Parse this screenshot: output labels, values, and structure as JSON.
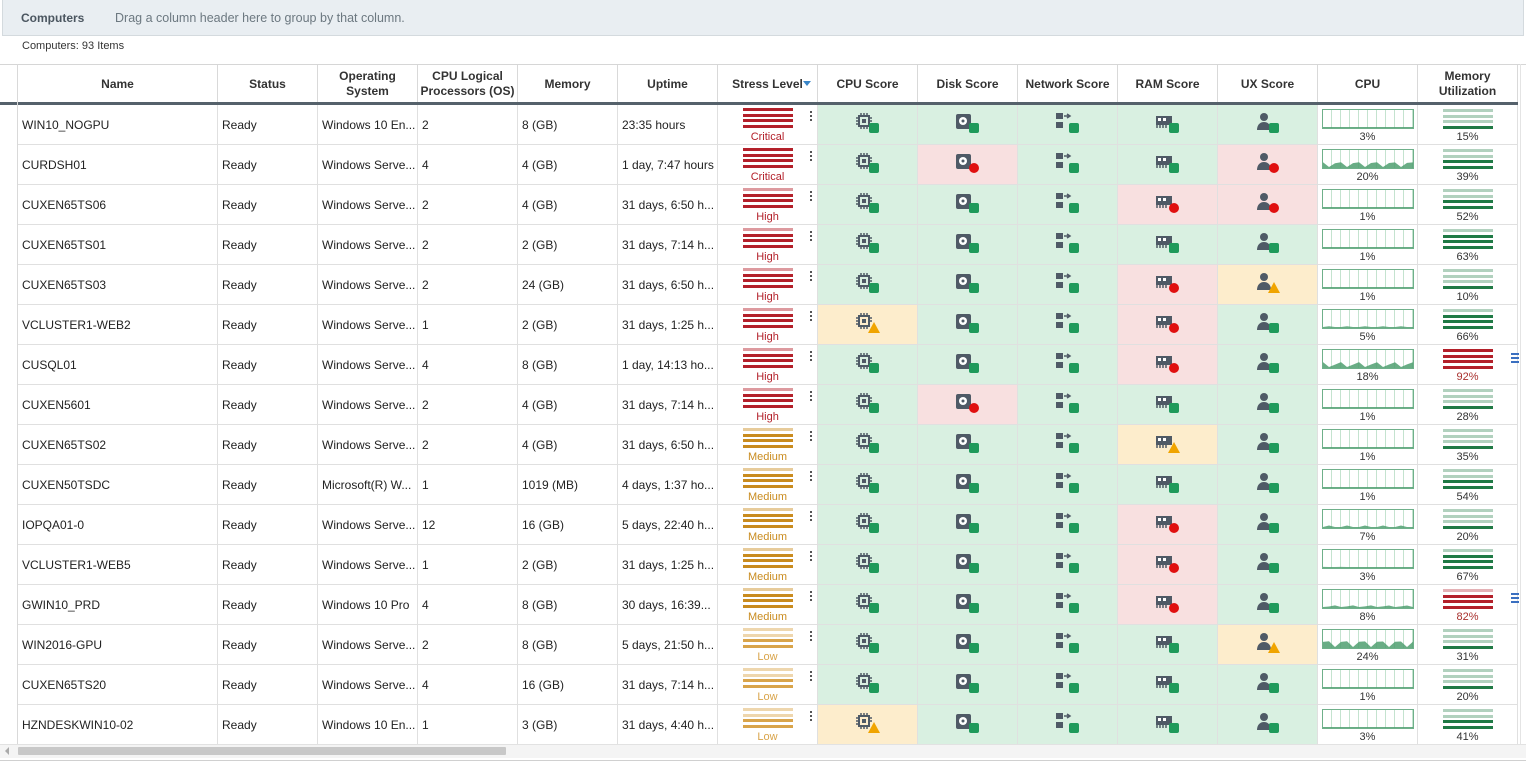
{
  "group_panel": {
    "title": "Computers",
    "hint": "Drag a column header here to group by that column."
  },
  "items_count": "Computers: 93 Items",
  "columns": [
    {
      "key": "name",
      "label": "Name"
    },
    {
      "key": "status",
      "label": "Status"
    },
    {
      "key": "os",
      "label": "Operating System"
    },
    {
      "key": "cpu_lp",
      "label": "CPU Logical Processors (OS)"
    },
    {
      "key": "memory",
      "label": "Memory"
    },
    {
      "key": "uptime",
      "label": "Uptime"
    },
    {
      "key": "stress",
      "label": "Stress Level",
      "sorted": "descending"
    },
    {
      "key": "cpu_score",
      "label": "CPU Score"
    },
    {
      "key": "disk_score",
      "label": "Disk Score"
    },
    {
      "key": "net_score",
      "label": "Network Score"
    },
    {
      "key": "ram_score",
      "label": "RAM Score"
    },
    {
      "key": "ux_score",
      "label": "UX Score"
    },
    {
      "key": "cpu",
      "label": "CPU"
    },
    {
      "key": "mem_util",
      "label": "Memory Utilization"
    }
  ],
  "colors": {
    "critical": "#b3202a",
    "high": "#b3202a",
    "medium": "#c98b1e",
    "low": "#d9a44a",
    "good_bg": "#d9f0e1",
    "bad_bg": "#f8e0e0",
    "warn_bg": "#fdedcc",
    "ok_badge": "#1f9a5b",
    "bad_badge": "#e01010",
    "warn_badge": "#f0a400",
    "icon_gray": "#4f5a66",
    "mem_green": "#1f7a45",
    "mem_red": "#b3202a"
  },
  "rows": [
    {
      "name": "WIN10_NOGPU",
      "status": "Ready",
      "os": "Windows 10 En...",
      "cpu_lp": "2",
      "memory": "8 (GB)",
      "uptime": "23:35 hours",
      "stress": "Critical",
      "scores": [
        "ok",
        "ok",
        "ok",
        "ok",
        "ok"
      ],
      "cpu": "3%",
      "cpu_level": 0.03,
      "mem": "15%",
      "mem_level": 0.15
    },
    {
      "name": "CURDSH01",
      "status": "Ready",
      "os": "Windows  Serve...",
      "cpu_lp": "4",
      "memory": "4 (GB)",
      "uptime": "1 day, 7:47 hours",
      "stress": "Critical",
      "scores": [
        "ok",
        "bad",
        "ok",
        "ok",
        "bad"
      ],
      "cpu": "20%",
      "cpu_level": 0.2,
      "mem": "39%",
      "mem_level": 0.39
    },
    {
      "name": "CUXEN65TS06",
      "status": "Ready",
      "os": "Windows  Serve...",
      "cpu_lp": "2",
      "memory": "4 (GB)",
      "uptime": "31 days, 6:50 h...",
      "stress": "High",
      "scores": [
        "ok",
        "ok",
        "ok",
        "bad",
        "bad"
      ],
      "cpu": "1%",
      "cpu_level": 0.01,
      "mem": "52%",
      "mem_level": 0.52
    },
    {
      "name": "CUXEN65TS01",
      "status": "Ready",
      "os": "Windows  Serve...",
      "cpu_lp": "2",
      "memory": "2 (GB)",
      "uptime": "31 days, 7:14 h...",
      "stress": "High",
      "scores": [
        "ok",
        "ok",
        "ok",
        "ok",
        "ok"
      ],
      "cpu": "1%",
      "cpu_level": 0.01,
      "mem": "63%",
      "mem_level": 0.63
    },
    {
      "name": "CUXEN65TS03",
      "status": "Ready",
      "os": "Windows  Serve...",
      "cpu_lp": "2",
      "memory": "24 (GB)",
      "uptime": "31 days, 6:50 h...",
      "stress": "High",
      "scores": [
        "ok",
        "ok",
        "ok",
        "bad",
        "warn"
      ],
      "cpu": "1%",
      "cpu_level": 0.01,
      "mem": "10%",
      "mem_level": 0.1
    },
    {
      "name": "VCLUSTER1-WEB2",
      "status": "Ready",
      "os": "Windows  Serve...",
      "cpu_lp": "1",
      "memory": "2 (GB)",
      "uptime": "31 days, 1:25 h...",
      "stress": "High",
      "scores": [
        "warn",
        "ok",
        "ok",
        "bad",
        "ok"
      ],
      "cpu": "5%",
      "cpu_level": 0.05,
      "mem": "66%",
      "mem_level": 0.66
    },
    {
      "name": "CUSQL01",
      "status": "Ready",
      "os": "Windows  Serve...",
      "cpu_lp": "4",
      "memory": "8 (GB)",
      "uptime": "1 day, 14:13 ho...",
      "stress": "High",
      "scores": [
        "ok",
        "ok",
        "ok",
        "bad",
        "ok"
      ],
      "cpu": "18%",
      "cpu_level": 0.18,
      "mem": "92%",
      "mem_level": 0.92
    },
    {
      "name": "CUXEN5601",
      "status": "Ready",
      "os": "Windows  Serve...",
      "cpu_lp": "2",
      "memory": "4 (GB)",
      "uptime": "31 days, 7:14 h...",
      "stress": "High",
      "scores": [
        "ok",
        "bad",
        "ok",
        "ok",
        "ok"
      ],
      "cpu": "1%",
      "cpu_level": 0.01,
      "mem": "28%",
      "mem_level": 0.28
    },
    {
      "name": "CUXEN65TS02",
      "status": "Ready",
      "os": "Windows  Serve...",
      "cpu_lp": "2",
      "memory": "4 (GB)",
      "uptime": "31 days, 6:50 h...",
      "stress": "Medium",
      "scores": [
        "ok",
        "ok",
        "ok",
        "warn",
        "ok"
      ],
      "cpu": "1%",
      "cpu_level": 0.01,
      "mem": "35%",
      "mem_level": 0.35
    },
    {
      "name": "CUXEN50TSDC",
      "status": "Ready",
      "os": "Microsoft(R) W...",
      "cpu_lp": "1",
      "memory": "1019 (MB)",
      "uptime": "4 days, 1:37 ho...",
      "stress": "Medium",
      "scores": [
        "ok",
        "ok",
        "ok",
        "ok",
        "ok"
      ],
      "cpu": "1%",
      "cpu_level": 0.01,
      "mem": "54%",
      "mem_level": 0.54
    },
    {
      "name": "IOPQA01-0",
      "status": "Ready",
      "os": "Windows  Serve...",
      "cpu_lp": "12",
      "memory": "16 (GB)",
      "uptime": "5 days, 22:40 h...",
      "stress": "Medium",
      "scores": [
        "ok",
        "ok",
        "ok",
        "bad",
        "ok"
      ],
      "cpu": "7%",
      "cpu_level": 0.07,
      "mem": "20%",
      "mem_level": 0.2
    },
    {
      "name": "VCLUSTER1-WEB5",
      "status": "Ready",
      "os": "Windows  Serve...",
      "cpu_lp": "1",
      "memory": "2 (GB)",
      "uptime": "31 days, 1:25 h...",
      "stress": "Medium",
      "scores": [
        "ok",
        "ok",
        "ok",
        "bad",
        "ok"
      ],
      "cpu": "3%",
      "cpu_level": 0.03,
      "mem": "67%",
      "mem_level": 0.67
    },
    {
      "name": "GWIN10_PRD",
      "status": "Ready",
      "os": "Windows 10 Pro",
      "cpu_lp": "4",
      "memory": "8 (GB)",
      "uptime": "30 days, 16:39...",
      "stress": "Medium",
      "scores": [
        "ok",
        "ok",
        "ok",
        "bad",
        "ok"
      ],
      "cpu": "8%",
      "cpu_level": 0.08,
      "mem": "82%",
      "mem_level": 0.82
    },
    {
      "name": "WIN2016-GPU",
      "status": "Ready",
      "os": "Windows  Serve...",
      "cpu_lp": "2",
      "memory": "8 (GB)",
      "uptime": "5 days, 21:50 h...",
      "stress": "Low",
      "scores": [
        "ok",
        "ok",
        "ok",
        "ok",
        "warn"
      ],
      "cpu": "24%",
      "cpu_level": 0.24,
      "mem": "31%",
      "mem_level": 0.31
    },
    {
      "name": "CUXEN65TS20",
      "status": "Ready",
      "os": "Windows  Serve...",
      "cpu_lp": "4",
      "memory": "16 (GB)",
      "uptime": "31 days, 7:14 h...",
      "stress": "Low",
      "scores": [
        "ok",
        "ok",
        "ok",
        "ok",
        "ok"
      ],
      "cpu": "1%",
      "cpu_level": 0.01,
      "mem": "20%",
      "mem_level": 0.2
    },
    {
      "name": "HZNDESKWIN10-02",
      "status": "Ready",
      "os": "Windows 10 En...",
      "cpu_lp": "1",
      "memory": "3 (GB)",
      "uptime": "31 days, 4:40 h...",
      "stress": "Low",
      "scores": [
        "warn",
        "ok",
        "ok",
        "ok",
        "ok"
      ],
      "cpu": "3%",
      "cpu_level": 0.03,
      "mem": "41%",
      "mem_level": 0.41
    }
  ]
}
